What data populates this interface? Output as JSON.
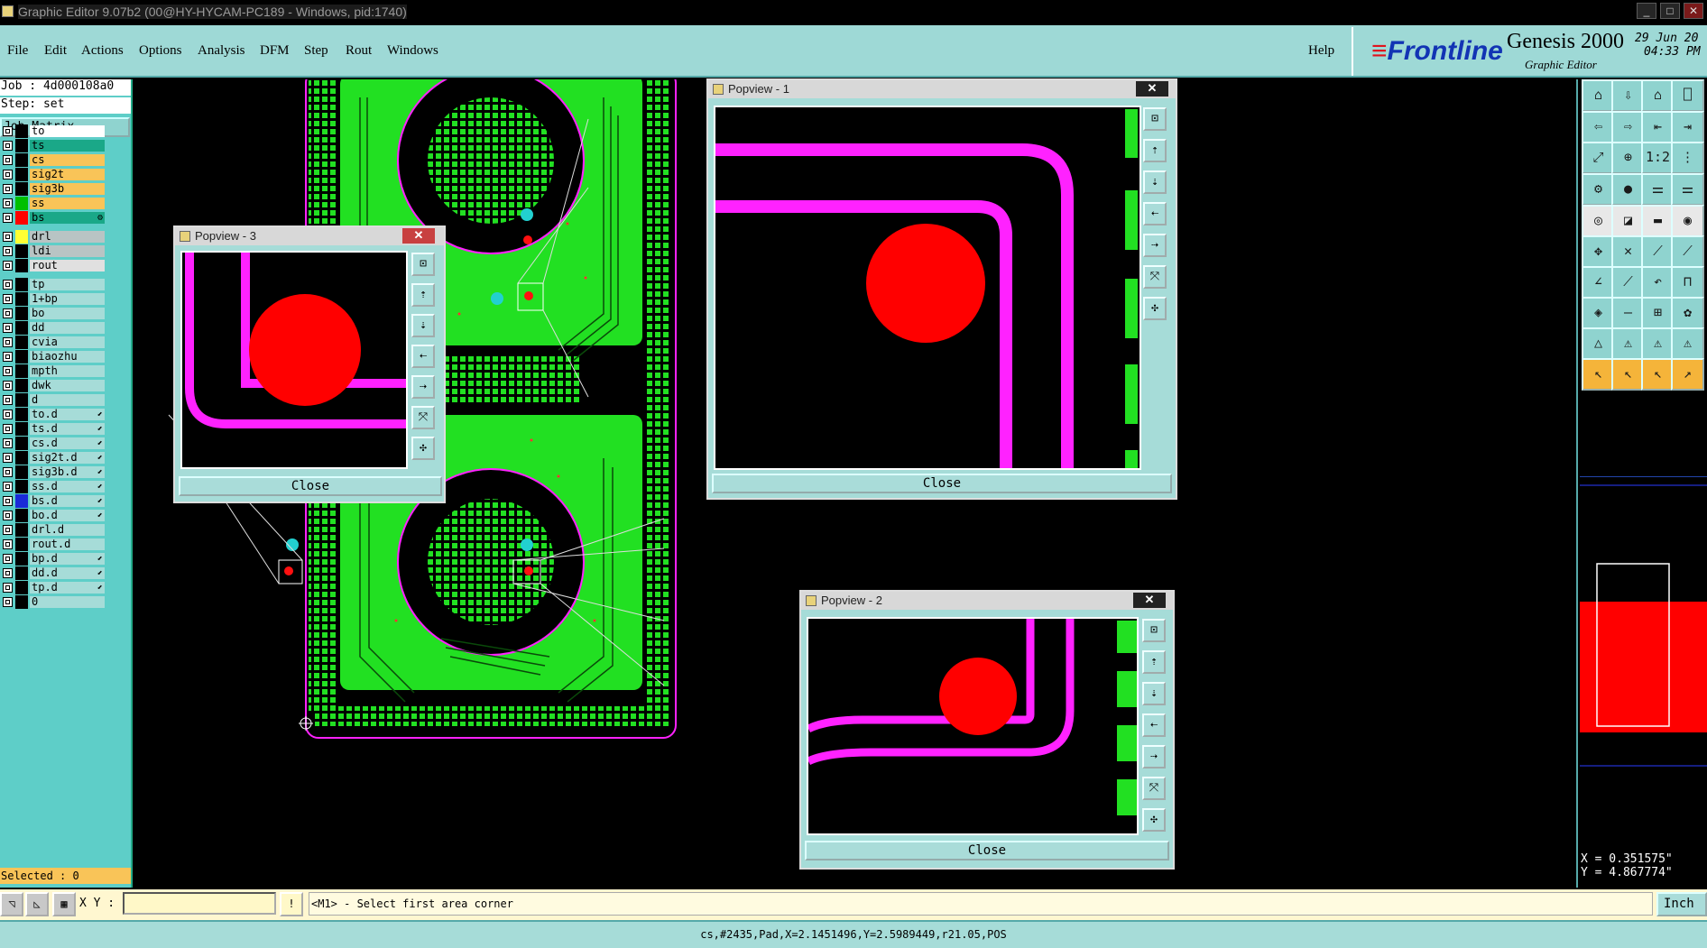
{
  "window": {
    "title": "Graphic Editor 9.07b2 (00@HY-HYCAM-PC189 - Windows, pid:1740)"
  },
  "menu": {
    "items": [
      "File",
      "Edit",
      "Actions",
      "Options",
      "Analysis",
      "DFM",
      "Step",
      "Rout",
      "Windows"
    ],
    "help": "Help"
  },
  "brand": {
    "logo": "Frontline",
    "product": "Genesis 2000",
    "subtitle": "Graphic Editor",
    "date": "29 Jun 20",
    "time": "04:33 PM"
  },
  "job": {
    "job_line": "Job : 4d000108a0",
    "step_line": "Step: set",
    "matrix_button": "Job Matrix ..."
  },
  "layers": [
    {
      "name": "to",
      "bg": "#ffffff",
      "color": "#000000"
    },
    {
      "name": "ts",
      "bg": "#1aa888",
      "color": "#000000"
    },
    {
      "name": "cs",
      "bg": "#f9c458",
      "color": "#000000"
    },
    {
      "name": "sig2t",
      "bg": "#f9c458",
      "color": "#000000"
    },
    {
      "name": "sig3b",
      "bg": "#f9c458",
      "color": "#000000"
    },
    {
      "name": "ss",
      "bg": "#f9c458",
      "color": "#00c000"
    },
    {
      "name": "bs",
      "bg": "#1aa888",
      "color": "#ff0000",
      "tag": "⚙"
    },
    {
      "name": "drl",
      "bg": "#b8c4c4",
      "color": "#ffff33"
    },
    {
      "name": "ldi",
      "bg": "#b8c4c4",
      "color": "#000000"
    },
    {
      "name": "rout",
      "bg": "#e0e0e0",
      "color": "#000000"
    },
    {
      "name": "tp",
      "bg": "#a6dcd8",
      "color": "#000000"
    },
    {
      "name": "1+bp",
      "bg": "#a6dcd8",
      "color": "#000000"
    },
    {
      "name": "bo",
      "bg": "#a6dcd8",
      "color": "#000000"
    },
    {
      "name": "dd",
      "bg": "#a6dcd8",
      "color": "#000000"
    },
    {
      "name": "cvia",
      "bg": "#a6dcd8",
      "color": "#000000"
    },
    {
      "name": "biaozhu",
      "bg": "#a6dcd8",
      "color": "#000000"
    },
    {
      "name": "mpth",
      "bg": "#a6dcd8",
      "color": "#000000"
    },
    {
      "name": "dwk",
      "bg": "#a6dcd8",
      "color": "#000000"
    },
    {
      "name": "d",
      "bg": "#a6dcd8",
      "color": "#000000"
    },
    {
      "name": "to.d",
      "bg": "#a6dcd8",
      "color": "#000000",
      "tag": "⬋"
    },
    {
      "name": "ts.d",
      "bg": "#a6dcd8",
      "color": "#000000",
      "tag": "⬋"
    },
    {
      "name": "cs.d",
      "bg": "#a6dcd8",
      "color": "#000000",
      "tag": "⬋"
    },
    {
      "name": "sig2t.d",
      "bg": "#a6dcd8",
      "color": "#000000",
      "tag": "⬋"
    },
    {
      "name": "sig3b.d",
      "bg": "#a6dcd8",
      "color": "#000000",
      "tag": "⬋"
    },
    {
      "name": "ss.d",
      "bg": "#a6dcd8",
      "color": "#000000",
      "tag": "⬋"
    },
    {
      "name": "bs.d",
      "bg": "#a6dcd8",
      "color": "#1a2ad8",
      "tag": "⬋"
    },
    {
      "name": "bo.d",
      "bg": "#a6dcd8",
      "color": "#000000",
      "tag": "⬋"
    },
    {
      "name": "drl.d",
      "bg": "#a6dcd8",
      "color": "#000000"
    },
    {
      "name": "rout.d",
      "bg": "#a6dcd8",
      "color": "#000000"
    },
    {
      "name": "bp.d",
      "bg": "#a6dcd8",
      "color": "#000000",
      "tag": "⬋"
    },
    {
      "name": "dd.d",
      "bg": "#a6dcd8",
      "color": "#000000",
      "tag": "⬋"
    },
    {
      "name": "tp.d",
      "bg": "#a6dcd8",
      "color": "#000000",
      "tag": "⬋"
    },
    {
      "name": "0",
      "bg": "#a6dcd8",
      "color": "#000000"
    }
  ],
  "selected": "Selected : 0",
  "popups": {
    "p1": {
      "title": "Popview - 1",
      "close": "Close"
    },
    "p2": {
      "title": "Popview - 2",
      "close": "Close"
    },
    "p3": {
      "title": "Popview - 3",
      "close": "Close"
    }
  },
  "status": {
    "xy_label": "X Y :",
    "xy_value": "",
    "prompt": "<M1> - Select first area corner",
    "unit": "Inch"
  },
  "info": "cs,#2435,Pad,X=2.1451496,Y=2.5989449,r21.05,POS",
  "coords": {
    "x": "X = 0.351575\"",
    "y": "Y = 4.867774\""
  },
  "colors": {
    "panel": "#5ecec8",
    "menubar": "#9ed9d6",
    "copper": "#22e022",
    "trace": "#ff22ff",
    "pad": "#ff0000",
    "accent_blue": "#1234b4"
  }
}
